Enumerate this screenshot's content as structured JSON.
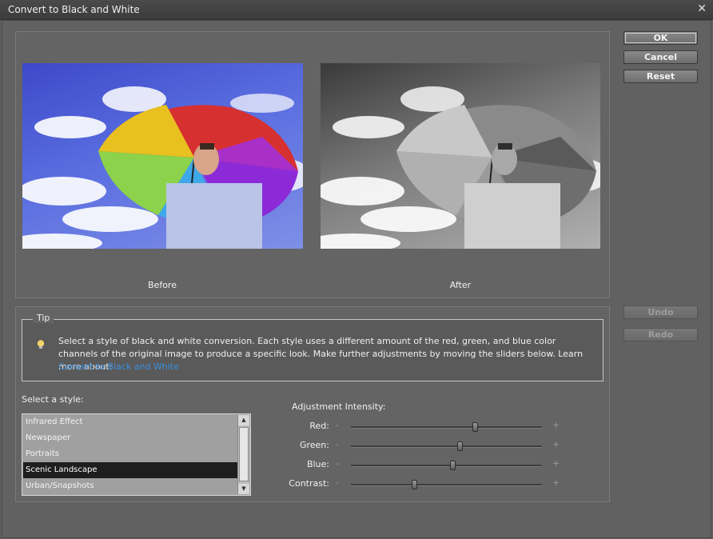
{
  "window": {
    "title": "Convert to Black and White",
    "close_glyph": "✕"
  },
  "preview": {
    "before_label": "Before",
    "after_label": "After"
  },
  "buttons": {
    "ok": "OK",
    "cancel": "Cancel",
    "reset": "Reset",
    "undo": "Undo",
    "redo": "Redo"
  },
  "tip": {
    "legend": "Tip",
    "icon": "lightbulb-icon",
    "text": "Select a style of black and white conversion. Each style uses a different amount of the red, green, and blue color channels of the original image to produce a specific look. Make further adjustments by moving the sliders below. Learn more about:",
    "link": "Convert to Black and White"
  },
  "styles": {
    "label": "Select a style:",
    "items": [
      "Infrared Effect",
      "Newspaper",
      "Portraits",
      "Scenic Landscape",
      "Urban/Snapshots"
    ],
    "selected": "Scenic Landscape"
  },
  "adjustments": {
    "label": "Adjustment Intensity:",
    "minus": "-",
    "plus": "+",
    "sliders": [
      {
        "name": "Red:",
        "value": 0.65
      },
      {
        "name": "Green:",
        "value": 0.57
      },
      {
        "name": "Blue:",
        "value": 0.53
      },
      {
        "name": "Contrast:",
        "value": 0.33
      }
    ]
  },
  "colors": {
    "accent_link": "#3a8fe0",
    "dialog_bg": "#616161",
    "selection": "#1e1e1e"
  }
}
